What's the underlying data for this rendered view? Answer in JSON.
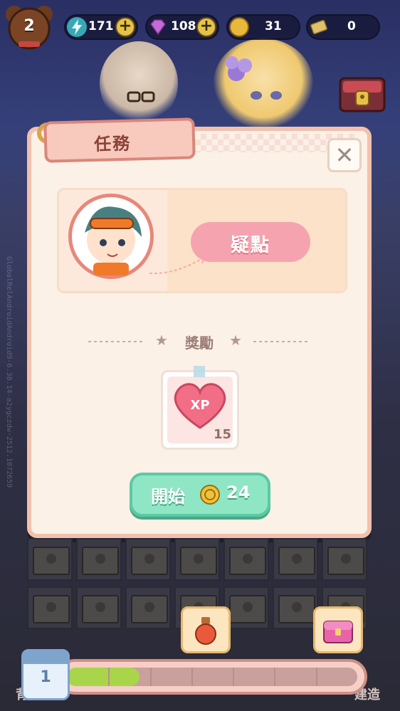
{
  "player": {
    "level": "2"
  },
  "resources": [
    {
      "name": "energy",
      "icon": "lightning-icon",
      "value": "171",
      "has_plus": true
    },
    {
      "name": "gems",
      "icon": "gem-icon",
      "value": "108",
      "has_plus": true
    },
    {
      "name": "coins",
      "icon": "coin-icon",
      "value": "31",
      "has_plus": false
    },
    {
      "name": "tickets",
      "icon": "ticket-icon",
      "value": "0",
      "has_plus": false
    }
  ],
  "modal": {
    "title": "任務",
    "quest_bubble": "疑點",
    "rewards_label": "獎勵",
    "reward": {
      "icon": "xp-heart-icon",
      "icon_text": "XP",
      "quantity": "15"
    },
    "start_button": {
      "label": "開始",
      "cost": "24",
      "cost_icon": "coin-icon"
    }
  },
  "bottom": {
    "day": "1",
    "progress": 0.25,
    "left_label": "背",
    "right_label": "建造"
  },
  "debug_text": "GlobalRelAndroidAndroid9-6.38.14-a2ygczdw-2512.1072659",
  "colors": {
    "accent_green": "#8fe6c5",
    "modal_bg": "#fbf1e6",
    "bubble_pink": "#f6a3b0"
  }
}
